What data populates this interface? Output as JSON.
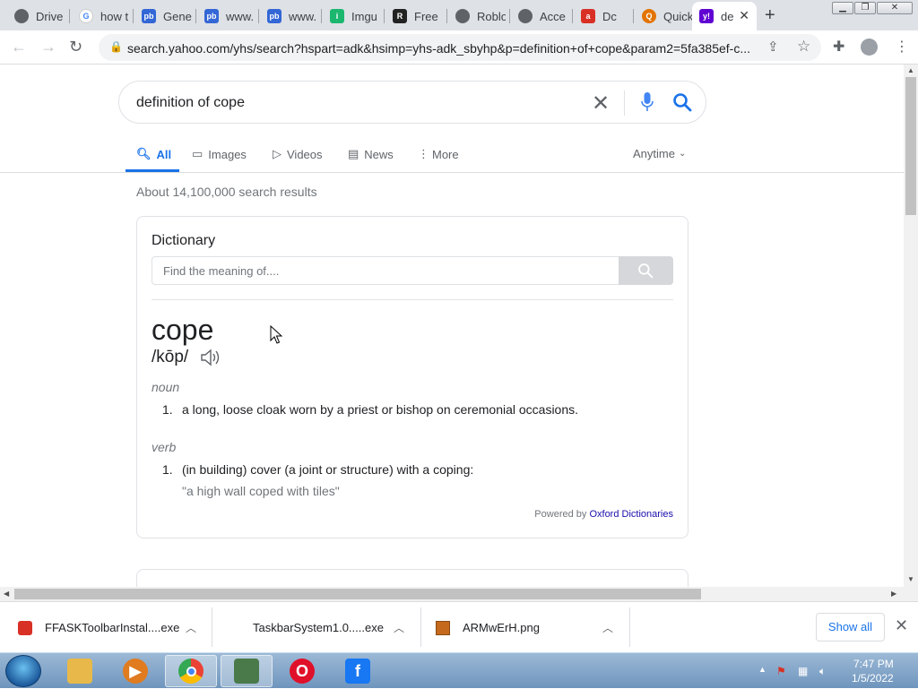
{
  "browser": {
    "tabs": [
      {
        "label": "Drive",
        "icon": "chrome-icon",
        "color": "#5f6368"
      },
      {
        "label": "how t",
        "icon": "google-icon",
        "color": "#4285f4"
      },
      {
        "label": "Gene",
        "icon": "pb-icon",
        "color": "#3367d6"
      },
      {
        "label": "www.",
        "icon": "pb-icon",
        "color": "#3367d6"
      },
      {
        "label": "www.",
        "icon": "pb-icon",
        "color": "#3367d6"
      },
      {
        "label": "Imgu",
        "icon": "imgur-icon",
        "color": "#1bb76e"
      },
      {
        "label": "Free",
        "icon": "roblox-icon",
        "color": "#222222"
      },
      {
        "label": "Roblo",
        "icon": "chrome-icon",
        "color": "#5f6368"
      },
      {
        "label": "Acce",
        "icon": "chrome-icon",
        "color": "#5f6368"
      },
      {
        "label": "Dc",
        "icon": "ask-icon",
        "color": "#d93025"
      },
      {
        "label": "Quick",
        "icon": "search-q-icon",
        "color": "#e37400"
      },
      {
        "label": "de",
        "icon": "yahoo-icon",
        "color": "#6001d2"
      }
    ],
    "new_tab_label": "+",
    "url": "search.yahoo.com/yhs/search?hspart=adk&hsimp=yhs-adk_sbyhp&p=definition+of+cope&param2=5fa385ef-c..."
  },
  "search": {
    "query": "definition of cope",
    "tabs": [
      {
        "label": "All",
        "icon": "search-icon"
      },
      {
        "label": "Images",
        "icon": "image-icon"
      },
      {
        "label": "Videos",
        "icon": "play-icon"
      },
      {
        "label": "News",
        "icon": "news-icon"
      },
      {
        "label": "More",
        "icon": "more-vert-icon"
      }
    ],
    "time_filter": "Anytime",
    "results_count": "About 14,100,000 search results"
  },
  "dictionary": {
    "title": "Dictionary",
    "input_placeholder": "Find the meaning of....",
    "word": "cope",
    "pronunciation": "/kōp/",
    "entries": [
      {
        "pos": "noun",
        "number": "1.",
        "definition": "a long, loose cloak worn by a priest or bishop on ceremonial occasions."
      },
      {
        "pos": "verb",
        "number": "1.",
        "definition": "(in building) cover (a joint or structure) with a coping:",
        "example": "\"a high wall coped with tiles\""
      }
    ],
    "powered_by": "Powered by",
    "source": "Oxford Dictionaries"
  },
  "downloads": {
    "items": [
      {
        "name": "FFASKToolbarInstal....exe",
        "icon": "ask-icon"
      },
      {
        "name": "TaskbarSystem1.0.....exe",
        "icon": "file-icon"
      },
      {
        "name": "ARMwErH.png",
        "icon": "image-file-icon"
      }
    ],
    "show_all": "Show all"
  },
  "taskbar": {
    "time": "7:47 PM",
    "date": "1/5/2022",
    "apps": [
      {
        "name": "file-explorer-icon",
        "color": "#e8b94a"
      },
      {
        "name": "media-player-icon",
        "color": "#e07b1f"
      },
      {
        "name": "chrome-icon",
        "color": "#34a853"
      },
      {
        "name": "notepad-icon",
        "color": "#4a7a4a"
      },
      {
        "name": "opera-icon",
        "color": "#e0102a"
      },
      {
        "name": "facebook-icon",
        "color": "#1877f2"
      }
    ]
  },
  "colors": {
    "accent": "#1a73e8",
    "link": "#1a0dab",
    "yahoo": "#6001d2"
  }
}
